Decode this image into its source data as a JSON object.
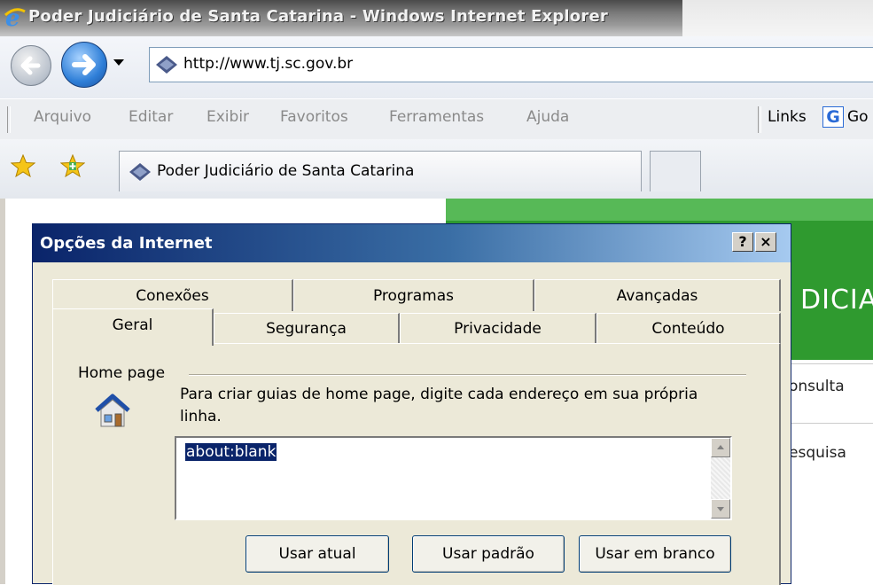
{
  "window": {
    "title": "Poder Judiciário de Santa Catarina - Windows Internet Explorer"
  },
  "address_bar": {
    "url": "http://www.tj.sc.gov.br"
  },
  "menu": {
    "items": [
      "Arquivo",
      "Editar",
      "Exibir",
      "Favoritos",
      "Ferramentas",
      "Ajuda"
    ],
    "links_label": "Links",
    "google_label": "Go"
  },
  "tabs_bar": {
    "active_tab_title": "Poder Judiciário de Santa Catarina"
  },
  "page": {
    "banner_text": "DICIA",
    "consulta_text": "onsulta",
    "pesquisa_text": "esquisa"
  },
  "dialog": {
    "title": "Opções da Internet",
    "help_label": "?",
    "close_label": "×",
    "tabs_back": [
      "Conexões",
      "Programas",
      "Avançadas"
    ],
    "tabs_front": [
      "Geral",
      "Segurança",
      "Privacidade",
      "Conteúdo"
    ],
    "active_tab": "Geral",
    "homepage": {
      "group_label": "Home page",
      "instructions": "Para criar guias de home page, digite cada endereço em sua própria linha.",
      "value": "about:blank",
      "buttons": {
        "use_current": "Usar atual",
        "use_default": "Usar padrão",
        "use_blank": "Usar em branco"
      }
    }
  },
  "colors": {
    "dialog_title_start": "#0a246a",
    "dialog_title_end": "#a6caf0",
    "dialog_bg": "#ece9d8",
    "banner_green": "#2f9a2f"
  },
  "icons": {
    "ie_logo": "ie-logo-icon",
    "back": "back-arrow-icon",
    "forward": "forward-arrow-icon",
    "favicon": "tj-favicon-icon",
    "favorites": "favorites-star-icon",
    "add_favorites": "add-favorites-icon",
    "house": "house-icon"
  }
}
